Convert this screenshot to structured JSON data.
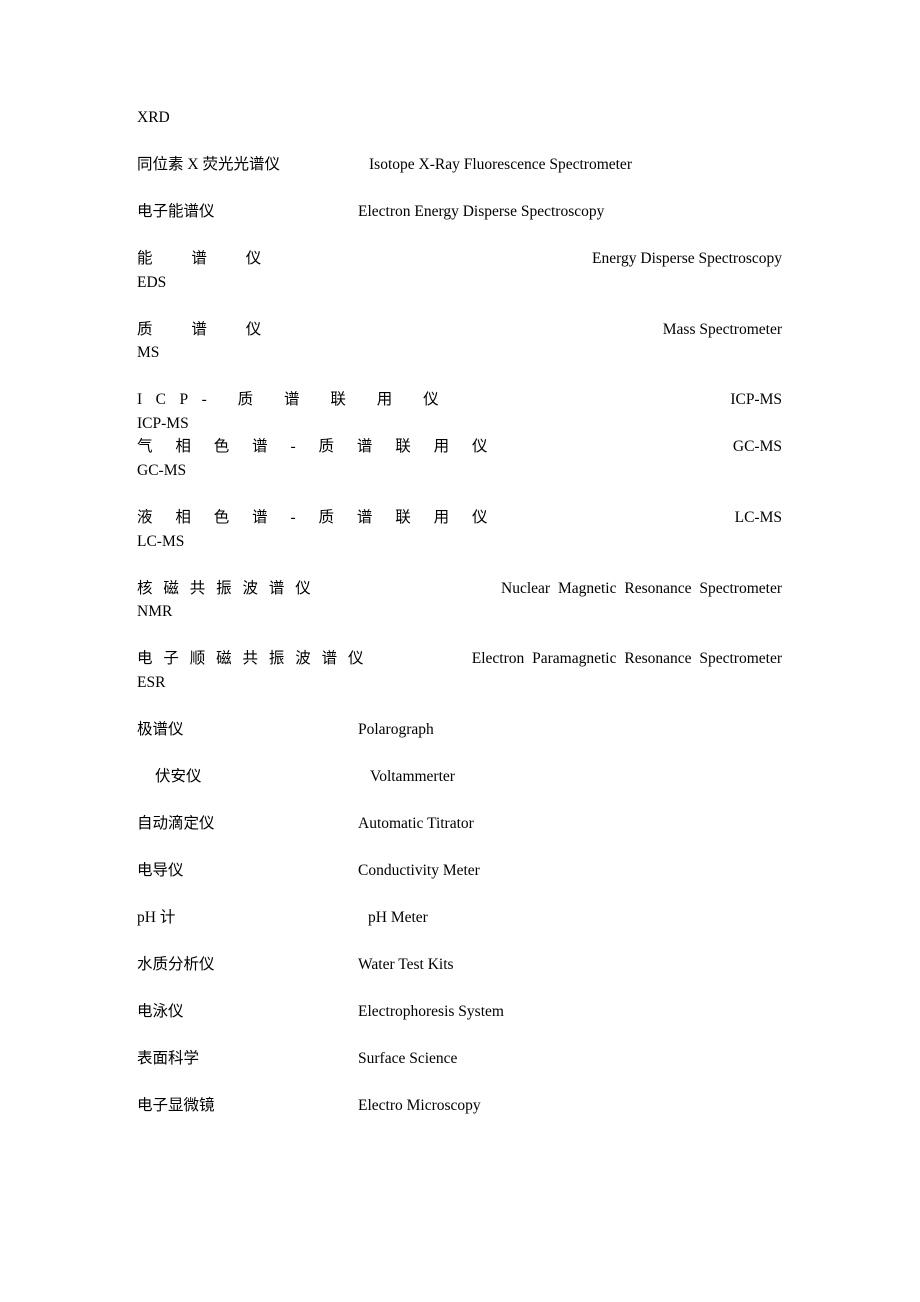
{
  "document": {
    "title": "XRD",
    "text_color": "#000000",
    "background_color": "#ffffff"
  },
  "entries": [
    {
      "id": "xrd",
      "zh": "XRD",
      "en": "",
      "abbr": "",
      "layout": "heading"
    },
    {
      "id": "xrf",
      "zh": "同位素 X 荧光光谱仪",
      "en": "Isotope X-Ray Fluorescence Spectrometer",
      "abbr": "",
      "layout": "columns-nudge"
    },
    {
      "id": "eeds",
      "zh": "电子能谱仪",
      "en": "Electron Energy Disperse Spectroscopy",
      "abbr": "",
      "layout": "columns"
    },
    {
      "id": "eds",
      "zh": "能 谱 仪",
      "en": "Energy  Disperse  Spectroscopy",
      "abbr": "EDS",
      "layout": "justified",
      "tracking": "sp-xl"
    },
    {
      "id": "ms",
      "zh": "质 谱 仪",
      "en": "Mass  Spectrometer",
      "abbr": "MS",
      "layout": "justified",
      "tracking": "sp-xl"
    },
    {
      "id": "icp-ms",
      "zh": "ICP- 质 谱 联 用 仪",
      "en": "ICP-MS",
      "abbr": "ICP-MS",
      "layout": "justified",
      "tracking": "sp-lg",
      "tight": true
    },
    {
      "id": "gc-ms",
      "zh": "气 相 色 谱 - 质 谱 联 用 仪",
      "en": "GC-MS",
      "abbr": "GC-MS",
      "layout": "justified",
      "tracking": "sp-md"
    },
    {
      "id": "lc-ms",
      "zh": "液 相 色 谱 - 质 谱 联 用 仪",
      "en": "LC-MS",
      "abbr": "LC-MS",
      "layout": "justified",
      "tracking": "sp-md"
    },
    {
      "id": "nmr",
      "zh": "核 磁 共 振 波 谱 仪",
      "en": "Nuclear  Magnetic  Resonance  Spectrometer",
      "abbr": "NMR",
      "layout": "justified",
      "tracking": "sp-sm"
    },
    {
      "id": "esr",
      "zh": "电 子 顺 磁 共 振 波 谱 仪",
      "en": "Electron  Paramagnetic  Resonance  Spectrometer",
      "abbr": "ESR",
      "layout": "justified",
      "tracking": "sp-sm"
    },
    {
      "id": "polarograph",
      "zh": "极谱仪",
      "en": "Polarograph",
      "abbr": "",
      "layout": "columns"
    },
    {
      "id": "voltammeter",
      "zh": "伏安仪",
      "en": "Voltammerter",
      "abbr": "",
      "layout": "columns-indent"
    },
    {
      "id": "titrator",
      "zh": "自动滴定仪",
      "en": "Automatic Titrator",
      "abbr": "",
      "layout": "columns"
    },
    {
      "id": "conductivity",
      "zh": "电导仪",
      "en": "Conductivity Meter",
      "abbr": "",
      "layout": "columns"
    },
    {
      "id": "ph-meter",
      "zh": "pH 计",
      "en": "pH Meter",
      "abbr": "",
      "layout": "columns-nudge2"
    },
    {
      "id": "water-test",
      "zh": "水质分析仪",
      "en": "Water Test Kits",
      "abbr": "",
      "layout": "columns"
    },
    {
      "id": "electrophoresis",
      "zh": "电泳仪",
      "en": "Electrophoresis System",
      "abbr": "",
      "layout": "columns"
    },
    {
      "id": "surface-science",
      "zh": "表面科学",
      "en": "Surface Science",
      "abbr": "",
      "layout": "columns"
    },
    {
      "id": "electro-microscopy",
      "zh": "电子显微镜",
      "en": "Electro Microscopy",
      "abbr": "",
      "layout": "columns"
    }
  ]
}
